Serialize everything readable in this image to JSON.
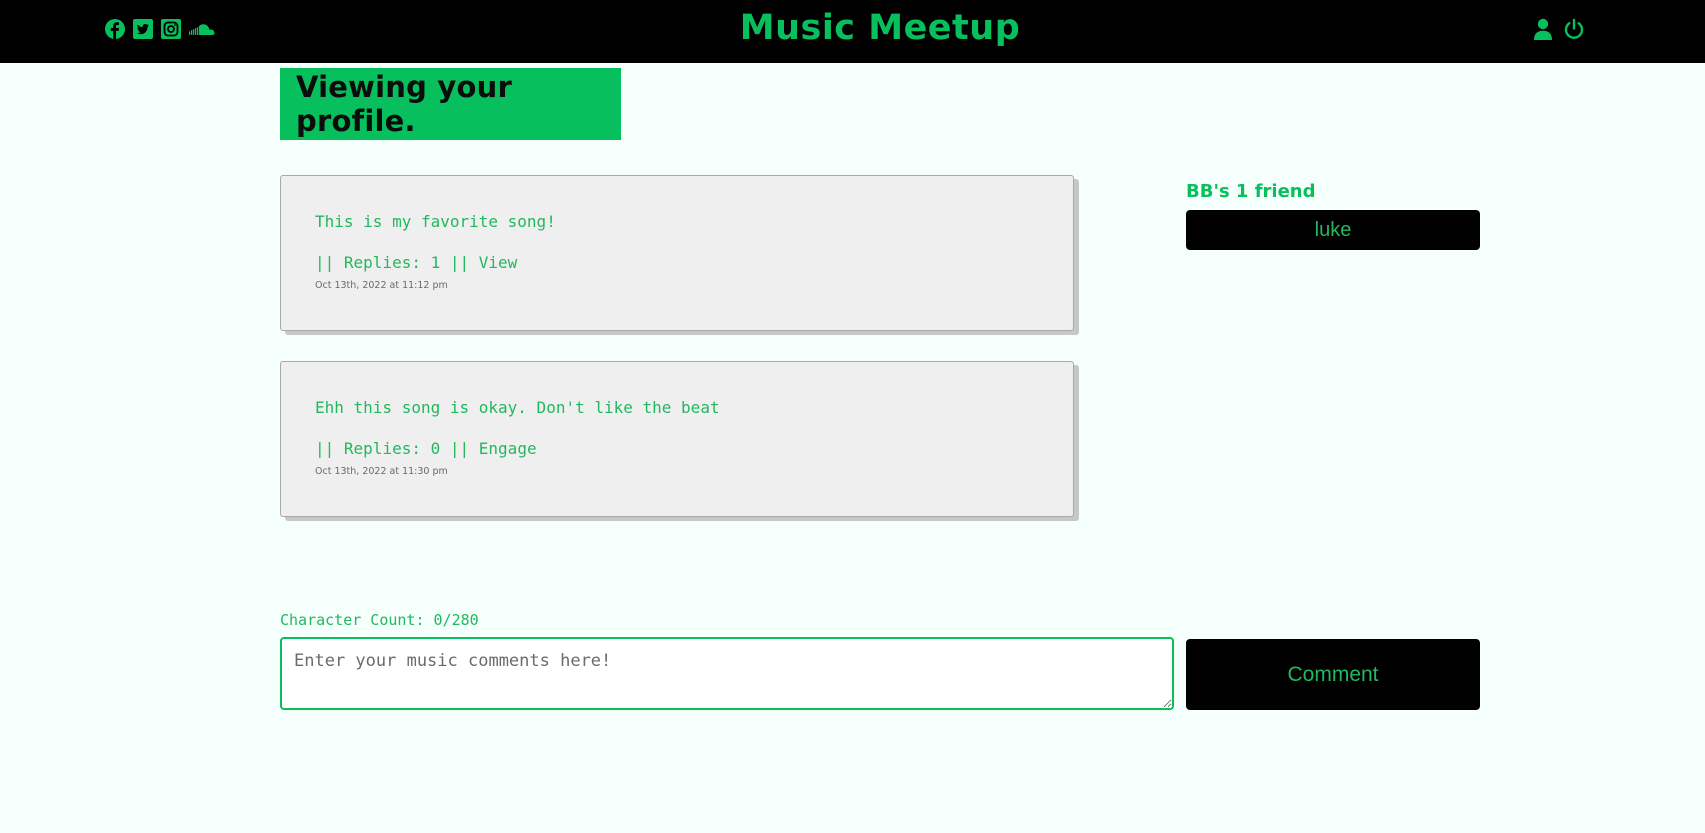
{
  "header": {
    "title": "Music Meetup",
    "social_icons": [
      "facebook-icon",
      "twitter-icon",
      "instagram-icon",
      "soundcloud-icon"
    ],
    "user_icons": [
      "user-icon",
      "power-icon"
    ]
  },
  "colors": {
    "accent": "#07bf5d",
    "background": "#f5fffc",
    "header_bg": "#000000",
    "post_bg": "#efefef"
  },
  "banner": {
    "text": "Viewing your profile."
  },
  "posts": [
    {
      "text": "This is my favorite song!",
      "separator_1": "||",
      "replies_label": "Replies: 1",
      "separator_2": "||",
      "action": "View",
      "date": "Oct 13th, 2022 at 11:12 pm"
    },
    {
      "text": "Ehh this song is okay. Don't like the beat",
      "separator_1": "||",
      "replies_label": "Replies: 0",
      "separator_2": "||",
      "action": "Engage",
      "date": "Oct 13th, 2022 at 11:30 pm"
    }
  ],
  "friends": {
    "heading": "BB's 1 friend",
    "list": [
      "luke"
    ]
  },
  "comment_form": {
    "char_count": "Character Count: 0/280",
    "placeholder": "Enter your music comments here!",
    "value": "",
    "button_label": "Comment"
  }
}
